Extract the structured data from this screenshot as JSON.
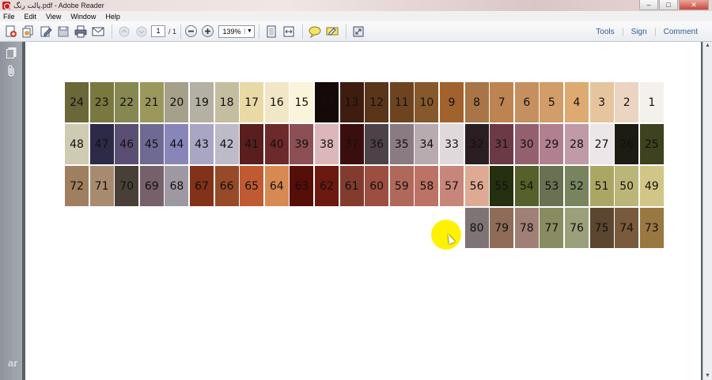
{
  "window": {
    "title": "پالت رنگ.pdf - Adobe Reader",
    "minimize": "–",
    "maximize": "□",
    "close": "✕"
  },
  "menu": [
    "File",
    "Edit",
    "View",
    "Window",
    "Help"
  ],
  "toolbar": {
    "page_current": "1",
    "page_total": "/ 1",
    "zoom": "139%",
    "zoom_arrow": "▼"
  },
  "right_panel_links": [
    "Tools",
    "Sign",
    "Comment"
  ],
  "watermark": "ar",
  "swatches": [
    {
      "n": "24",
      "c": "#6a6838"
    },
    {
      "n": "23",
      "c": "#787840"
    },
    {
      "n": "22",
      "c": "#878752"
    },
    {
      "n": "21",
      "c": "#9c985c"
    },
    {
      "n": "20",
      "c": "#a6a08a"
    },
    {
      "n": "19",
      "c": "#b4b1a4"
    },
    {
      "n": "18",
      "c": "#c4bda0"
    },
    {
      "n": "17",
      "c": "#e8d9a5"
    },
    {
      "n": "16",
      "c": "#f1e6c6"
    },
    {
      "n": "15",
      "c": "#faf4da"
    },
    {
      "n": "14",
      "c": "#160a08"
    },
    {
      "n": "13",
      "c": "#3e1d10"
    },
    {
      "n": "12",
      "c": "#5a3518"
    },
    {
      "n": "11",
      "c": "#6e4320"
    },
    {
      "n": "10",
      "c": "#86582c"
    },
    {
      "n": "9",
      "c": "#a2622e"
    },
    {
      "n": "8",
      "c": "#a97547"
    },
    {
      "n": "7",
      "c": "#bd8452"
    },
    {
      "n": "6",
      "c": "#c58f5f"
    },
    {
      "n": "5",
      "c": "#d29d68"
    },
    {
      "n": "4",
      "c": "#ddab72"
    },
    {
      "n": "3",
      "c": "#e6c49e"
    },
    {
      "n": "2",
      "c": "#ecd4c2"
    },
    {
      "n": "1",
      "c": "#f4f1ec"
    },
    {
      "n": "48",
      "c": "#cfcab2"
    },
    {
      "n": "47",
      "c": "#2d2a48"
    },
    {
      "n": "46",
      "c": "#5a4f72"
    },
    {
      "n": "45",
      "c": "#6f6a92"
    },
    {
      "n": "44",
      "c": "#8886b8"
    },
    {
      "n": "43",
      "c": "#a9a5c4"
    },
    {
      "n": "42",
      "c": "#bdbac9"
    },
    {
      "n": "41",
      "c": "#5a1e1e"
    },
    {
      "n": "40",
      "c": "#6e2a2a"
    },
    {
      "n": "39",
      "c": "#8c4f54"
    },
    {
      "n": "38",
      "c": "#dbb7b9"
    },
    {
      "n": "37",
      "c": "#3a0e0c"
    },
    {
      "n": "36",
      "c": "#4e4248"
    },
    {
      "n": "35",
      "c": "#8a7a82"
    },
    {
      "n": "34",
      "c": "#b8abb0"
    },
    {
      "n": "33",
      "c": "#e0d8da"
    },
    {
      "n": "32",
      "c": "#2a1e22"
    },
    {
      "n": "31",
      "c": "#6c3a46"
    },
    {
      "n": "30",
      "c": "#946070"
    },
    {
      "n": "29",
      "c": "#b08090"
    },
    {
      "n": "28",
      "c": "#c09aa6"
    },
    {
      "n": "27",
      "c": "#ece6e8"
    },
    {
      "n": "26",
      "c": "#1c1c12"
    },
    {
      "n": "25",
      "c": "#3e421e"
    },
    {
      "n": "72",
      "c": "#a07e60"
    },
    {
      "n": "71",
      "c": "#a88a6e"
    },
    {
      "n": "70",
      "c": "#484038"
    },
    {
      "n": "69",
      "c": "#76606a"
    },
    {
      "n": "68",
      "c": "#9d98a2"
    },
    {
      "n": "67",
      "c": "#823218"
    },
    {
      "n": "66",
      "c": "#964a28"
    },
    {
      "n": "65",
      "c": "#c05a32"
    },
    {
      "n": "64",
      "c": "#d68a52"
    },
    {
      "n": "63",
      "c": "#560e08"
    },
    {
      "n": "62",
      "c": "#6c1a10"
    },
    {
      "n": "61",
      "c": "#823c2e"
    },
    {
      "n": "60",
      "c": "#9c4e40"
    },
    {
      "n": "59",
      "c": "#b0685a"
    },
    {
      "n": "58",
      "c": "#bc7264"
    },
    {
      "n": "57",
      "c": "#c8867a"
    },
    {
      "n": "56",
      "c": "#deaa94"
    },
    {
      "n": "55",
      "c": "#243010"
    },
    {
      "n": "54",
      "c": "#56602a"
    },
    {
      "n": "53",
      "c": "#6a7052"
    },
    {
      "n": "52",
      "c": "#78845e"
    },
    {
      "n": "51",
      "c": "#aca664"
    },
    {
      "n": "50",
      "c": "#bcb578"
    },
    {
      "n": "49",
      "c": "#d1c686"
    },
    {
      "n": "80",
      "c": "#7e7476"
    },
    {
      "n": "79",
      "c": "#8e6c58"
    },
    {
      "n": "78",
      "c": "#a08076"
    },
    {
      "n": "77",
      "c": "#888c60"
    },
    {
      "n": "76",
      "c": "#9ca07a"
    },
    {
      "n": "75",
      "c": "#5c4630"
    },
    {
      "n": "74",
      "c": "#7a5a3c"
    },
    {
      "n": "73",
      "c": "#9a7842"
    }
  ]
}
